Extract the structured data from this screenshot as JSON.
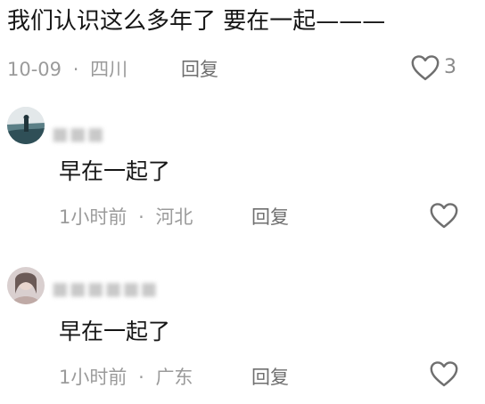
{
  "main_comment": {
    "text": "我们认识这么多年了 要在一起———",
    "date": "10-09",
    "sep": "·",
    "location": "四川",
    "reply_label": "回复",
    "like_count": "3"
  },
  "replies": [
    {
      "username": "■■■",
      "text": "早在一起了",
      "time": "1小时前",
      "sep": "·",
      "location": "河北",
      "reply_label": "回复"
    },
    {
      "username": "■■■■■■",
      "text": "早在一起了",
      "time": "1小时前",
      "sep": "·",
      "location": "广东",
      "reply_label": "回复"
    }
  ],
  "colors": {
    "text": "#161616",
    "meta": "#9b9b9b",
    "icon": "#6f6f6f"
  }
}
